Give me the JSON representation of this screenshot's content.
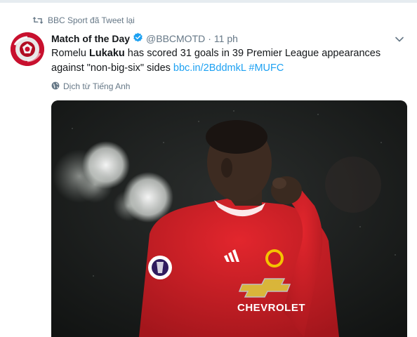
{
  "retweet": {
    "icon": "retweet-icon",
    "text": "BBC Sport đã Tweet lại"
  },
  "tweet": {
    "author_name": "Match of the Day",
    "handle": "@BBCMOTD",
    "separator": "·",
    "time": "11 ph",
    "verified_icon": "verified-badge-icon",
    "menu_icon": "chevron-down-icon",
    "text_before": "Romelu ",
    "text_bold": "Lukaku",
    "text_after": " has scored 31 goals in 39 Premier League appearances against \"non-big-six\" sides ",
    "link": "bbc.in/2BddmkL",
    "hashtag": "#MUFC",
    "translate_label": "Dịch từ Tiếng Anh",
    "translate_icon": "globe-icon"
  },
  "media": {
    "jersey_sponsor": "CHEVROLET",
    "jersey_brand": "adidas"
  },
  "colors": {
    "link": "#1da1f2",
    "muted": "#657786",
    "verified": "#1da1f2",
    "jersey_red": "#d11f26"
  }
}
